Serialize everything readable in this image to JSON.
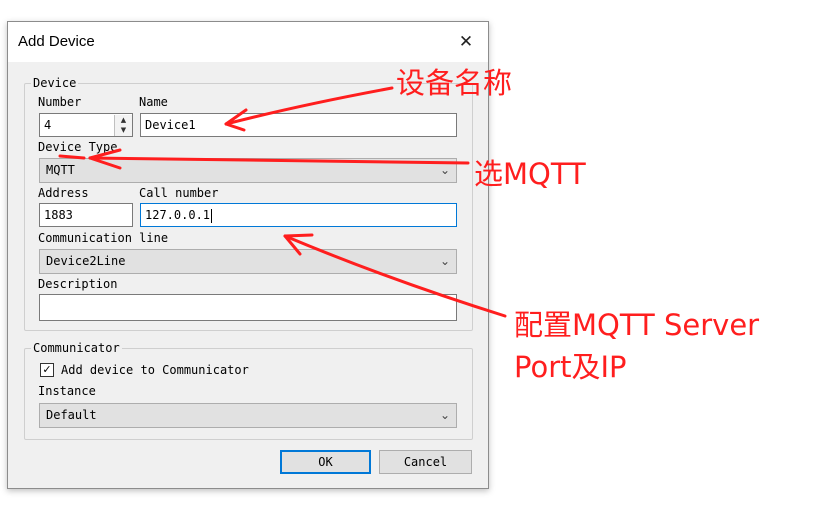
{
  "dialog": {
    "title": "Add Device",
    "close_icon": "close-icon"
  },
  "device_group": {
    "legend": "Device",
    "number_label": "Number",
    "number_value": "4",
    "name_label": "Name",
    "name_value": "Device1",
    "device_type_label": "Device Type",
    "device_type_value": "MQTT",
    "address_label": "Address",
    "address_value": "1883",
    "call_number_label": "Call number",
    "call_number_value": "127.0.0.1",
    "comm_line_label": "Communication line",
    "comm_line_value": "Device2Line",
    "description_label": "Description",
    "description_value": ""
  },
  "communicator_group": {
    "legend": "Communicator",
    "add_device_label": "Add device to Communicator",
    "add_device_checked": true,
    "instance_label": "Instance",
    "instance_value": "Default"
  },
  "buttons": {
    "ok": "OK",
    "cancel": "Cancel"
  },
  "annotations": {
    "name_note": "设备名称",
    "type_note": "选MQTT",
    "server_note_line1": "配置MQTT Server",
    "server_note_line2": "Port及IP",
    "color": "#ff1e1e"
  }
}
